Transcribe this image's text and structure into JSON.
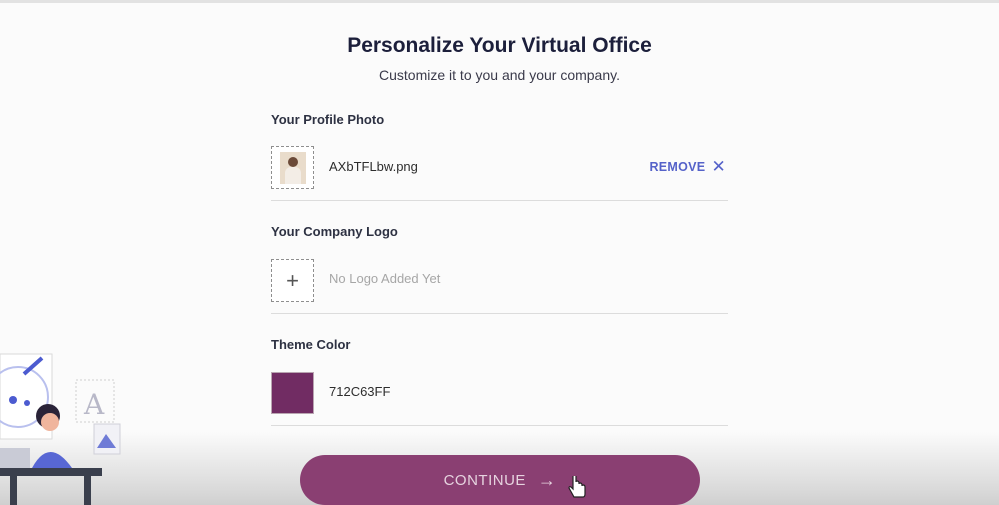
{
  "page": {
    "title": "Personalize Your Virtual Office",
    "subtitle": "Customize it to you and your company."
  },
  "profile_photo": {
    "label": "Your Profile Photo",
    "filename": "AXbTFLbw.png",
    "remove_label": "REMOVE",
    "remove_icon": "close-icon"
  },
  "company_logo": {
    "label": "Your Company Logo",
    "placeholder": "No Logo Added Yet",
    "add_icon": "plus-icon"
  },
  "theme_color": {
    "label": "Theme Color",
    "value": "712C63FF",
    "swatch_hex": "#712C63"
  },
  "continue_button": {
    "label": "CONTINUE",
    "icon": "arrow-right-icon"
  },
  "colors": {
    "accent_link": "#5562C9",
    "button_bg": "#8A3F72"
  }
}
